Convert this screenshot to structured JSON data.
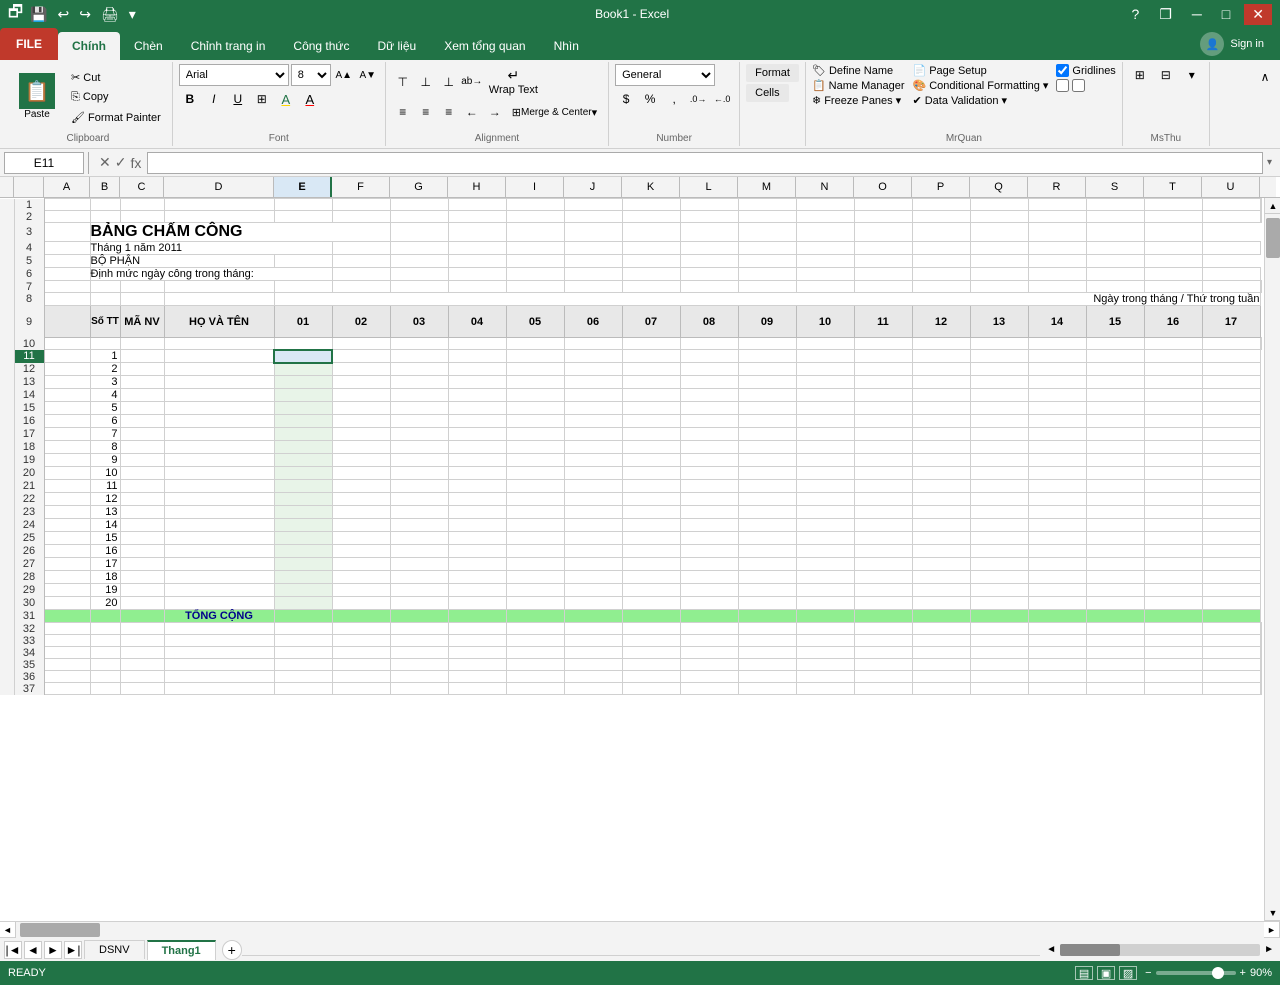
{
  "titleBar": {
    "title": "Book1 - Excel",
    "helpBtn": "?",
    "restoreBtn": "❐",
    "minimizeBtn": "─",
    "maximizeBtn": "□",
    "closeBtn": "✕"
  },
  "ribbonTabs": [
    {
      "label": "FILE",
      "id": "file",
      "isFile": true
    },
    {
      "label": "Chính",
      "id": "chinh",
      "active": true
    },
    {
      "label": "Chèn",
      "id": "chen"
    },
    {
      "label": "Chỉnh trang in",
      "id": "chinhtrangin"
    },
    {
      "label": "Công thức",
      "id": "congthuc"
    },
    {
      "label": "Dữ liệu",
      "id": "dulieu"
    },
    {
      "label": "Xem tổng quan",
      "id": "xemtongquan"
    },
    {
      "label": "Nhìn",
      "id": "nhin"
    }
  ],
  "signIn": "Sign in",
  "groups": {
    "clipboard": {
      "label": "Clipboard",
      "paste": "Paste",
      "cut": "✂",
      "copy": "⎘",
      "formatPainter": "🖌"
    },
    "font": {
      "label": "Font",
      "fontName": "Arial",
      "fontSize": "8",
      "boldLabel": "B",
      "italicLabel": "I",
      "underlineLabel": "U",
      "increaseFont": "A▲",
      "decreaseFont": "A▼",
      "borders": "⊞",
      "fillColor": "A",
      "fontColor": "A"
    },
    "alignment": {
      "label": "Alignment",
      "wrapText": "Wrap Text",
      "mergeCenter": "Merge & Center",
      "alignLeft": "≡",
      "alignCenter": "≡",
      "alignRight": "≡",
      "indentLeft": "←",
      "indentRight": "→",
      "topAlign": "⊤",
      "middleAlign": "⊥",
      "bottomAlign": "⊥",
      "orientText": "ab→",
      "expandAlign": "⌄"
    },
    "number": {
      "label": "Number",
      "format": "General",
      "currency": "$",
      "percent": "%",
      "comma": ",",
      "increaseDecimal": "⁰⁰⁺",
      "decreaseDecimal": "⁰⁰₋",
      "expandNum": "⌄"
    },
    "cells": {
      "label": "",
      "formatCells": "Format\nCells"
    },
    "mrquan": {
      "label": "MrQuan",
      "defineName": "Define Name",
      "nameManager": "Name Manager",
      "freezePanes": "Freeze Panes",
      "pageSetup": "Page Setup",
      "conditionalFormatting": "Conditional Formatting",
      "dataValidation": "Data Validation",
      "gridlines": "Gridlines",
      "checkboxGridlines": true,
      "expandMrQuan": "⌄"
    },
    "msthu": {
      "label": "MsThu",
      "icon1": "⊞",
      "icon2": "⊟",
      "expandMsThu": "⌄"
    }
  },
  "formulaBar": {
    "cellRef": "E11",
    "cancelIcon": "✕",
    "confirmIcon": "✓",
    "functionIcon": "fx"
  },
  "spreadsheet": {
    "columns": [
      "A",
      "B",
      "C",
      "D",
      "E",
      "F",
      "G",
      "H",
      "I",
      "J",
      "K",
      "L",
      "M",
      "N",
      "O",
      "P",
      "Q",
      "R",
      "S",
      "T",
      "U"
    ],
    "selectedCol": "E",
    "selectedCell": "E11",
    "rows": {
      "count": 37,
      "selectedRow": 11
    }
  },
  "sheetContent": {
    "row3": {
      "col_b": "BẢNG CHẤM CÔNG"
    },
    "row4": {
      "col_b": "Tháng 1 năm 2011"
    },
    "row5": {
      "col_b": "BỘ PHẬN"
    },
    "row6": {
      "col_b": "Định mức ngày công trong tháng:"
    },
    "row8": {
      "col_e_onwards": "Ngày trong tháng / Thứ trong tuần"
    },
    "row9": {
      "col_b": "Số TT",
      "col_c": "MÃ NV",
      "col_d": "HỌ VÀ TÊN",
      "dates": [
        "01",
        "02",
        "03",
        "04",
        "05",
        "06",
        "07",
        "08",
        "09",
        "10",
        "11",
        "12",
        "13",
        "14",
        "15",
        "16",
        "17"
      ]
    },
    "numbers": [
      "1",
      "2",
      "3",
      "4",
      "5",
      "6",
      "7",
      "8",
      "9",
      "10",
      "11",
      "12",
      "13",
      "14",
      "15",
      "16",
      "17",
      "18",
      "19",
      "20"
    ],
    "tongCong": "TỔNG CỘNG"
  },
  "sheetTabs": [
    {
      "label": "DSNV",
      "active": false
    },
    {
      "label": "Thang1",
      "active": true
    }
  ],
  "statusBar": {
    "ready": "READY",
    "zoomLevel": "90%"
  }
}
